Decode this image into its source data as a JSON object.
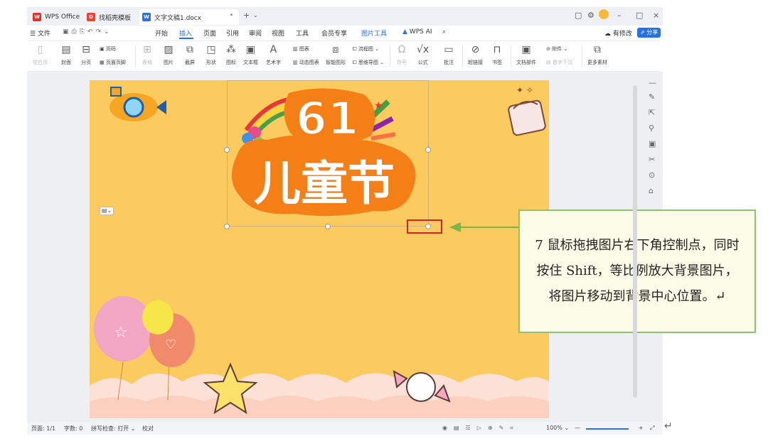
{
  "titlebar": {
    "tabs": [
      {
        "label": "WPS Office",
        "icon": "wps-logo-icon",
        "color": "#d9342b"
      },
      {
        "label": "找稻壳模板",
        "icon": "docer-icon",
        "color": "#e8452c"
      },
      {
        "label": "文字文稿1.docx",
        "icon": "word-doc-icon",
        "color": "#2b6fe0"
      }
    ],
    "new_tab": "+"
  },
  "menu": {
    "items": [
      "文件",
      "开始",
      "插入",
      "页面",
      "引用",
      "审阅",
      "视图",
      "工具",
      "会员专享",
      "图片工具"
    ],
    "active": "插入",
    "wps_ai": "WPS AI",
    "modified": "有修改",
    "share": "分享"
  },
  "ribbon": {
    "blank_page": "空白页",
    "cover": "封面",
    "page_break": "分页",
    "page_number": "页码",
    "header_footer": "页眉页脚",
    "table": "表格",
    "picture": "图片",
    "screenshot": "截屏",
    "shape": "形状",
    "icon": "图标",
    "textbox": "文本框",
    "wordart": "艺术字",
    "chart": "图表",
    "dynamic_chart": "动态图表",
    "smart_graphic": "智能图形",
    "flowchart": "流程图",
    "mindmap": "思维导图",
    "symbol": "符号",
    "formula": "公式",
    "comment": "批注",
    "hyperlink": "超链接",
    "bookmark": "书签",
    "doc_parts": "文档部件",
    "attachment": "附件",
    "drop_cap": "首字下沉",
    "more_material": "更多素材"
  },
  "document": {
    "festival_number": "61",
    "festival_title": "儿童节"
  },
  "callout": {
    "text": "7 鼠标拖拽图片右下角控制点，同时按住 Shift，等比例放大背景图片，将图片移动到背景中心位置。↵"
  },
  "status": {
    "page": "页面: 1/1",
    "words": "字数: 0",
    "spellcheck": "拼写检查: 打开",
    "proof": "校对",
    "zoom": "100%"
  },
  "colors": {
    "accent": "#2b6fe0",
    "page_bg": "#fccb5f",
    "callout_border": "#8dc26f",
    "callout_bg": "#fbfbe8",
    "highlight_red": "#e02020",
    "arrow_green": "#7ab648"
  }
}
